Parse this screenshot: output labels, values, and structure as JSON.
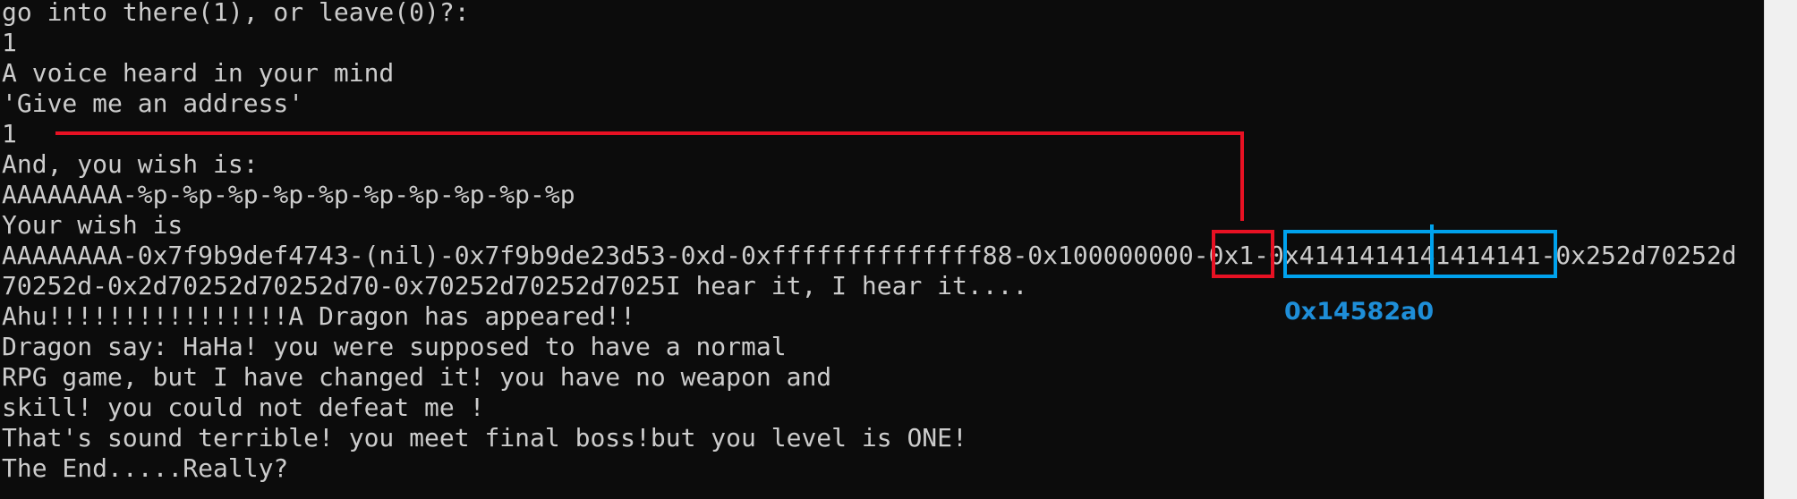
{
  "terminal": {
    "lines": [
      "go into there(1), or leave(0)?:",
      "1",
      "A voice heard in your mind",
      "'Give me an address'",
      "1",
      "And, you wish is:",
      "AAAAAAAA-%p-%p-%p-%p-%p-%p-%p-%p-%p-%p",
      "Your wish is",
      "AAAAAAAA-0x7f9b9def4743-(nil)-0x7f9b9de23d53-0xd-0xffffffffffffff88-0x100000000-0x1-0x4141414141414141-0x252d70252d",
      "70252d-0x2d70252d70252d70-0x70252d70252d7025I hear it, I hear it....",
      "Ahu!!!!!!!!!!!!!!!!A Dragon has appeared!!",
      "Dragon say: HaHa! you were supposed to have a normal",
      "RPG game, but I have changed it! you have no weapon and",
      "skill! you could not defeat me !",
      "That's sound terrible! you meet final boss!but you level is ONE!",
      "The End.....Really?"
    ]
  },
  "annotations": {
    "blue_label": "0x14582a0",
    "red_color": "#e81123",
    "blue_color": "#00a2ed"
  }
}
